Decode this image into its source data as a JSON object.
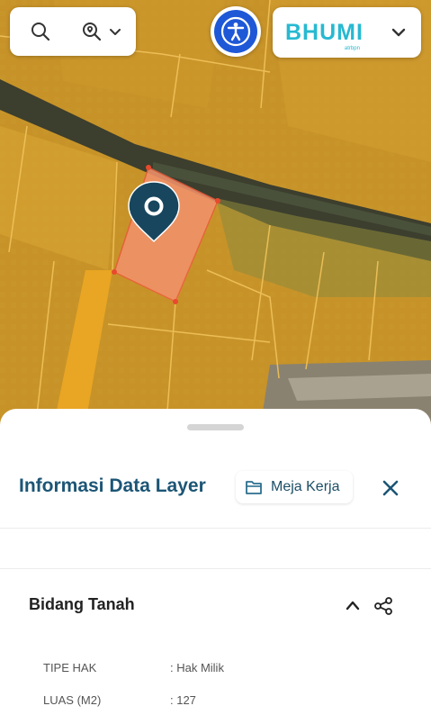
{
  "map": {
    "pin_icon": "map-pin-icon",
    "selected_parcel_color": "#f0916a",
    "layer_color": "#e9a524"
  },
  "toolbar": {
    "search_icon": "search-icon",
    "location_search_icon": "location-search-icon",
    "dropdown_icon": "chevron-down-icon",
    "accessibility_icon": "accessibility-icon",
    "accessibility_color": "#1e58d7"
  },
  "brand": {
    "logo_text": "BHUMI",
    "logo_sub": "atrbpn",
    "color": "#27b9d1"
  },
  "panel": {
    "title": "Informasi Data Layer",
    "meja_kerja_label": "Meja Kerja",
    "section_title": "Bidang Tanah",
    "rows": [
      {
        "key": "TIPE HAK",
        "value": ": Hak Milik"
      },
      {
        "key": "LUAS (M2)",
        "value": ": 127"
      }
    ]
  }
}
